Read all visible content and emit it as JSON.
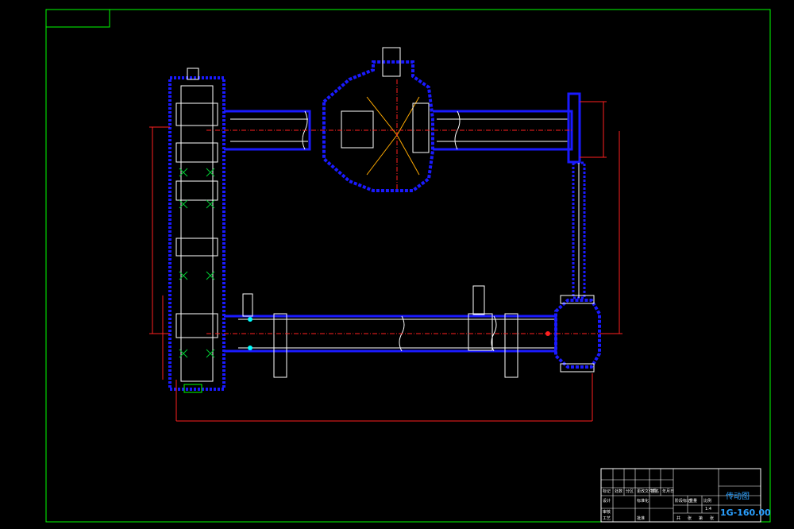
{
  "title_block": {
    "drawing_name": "传动图",
    "drawing_code": "1G-160.00",
    "labels": [
      "标记",
      "处数",
      "分区",
      "更改文件号",
      "签名",
      "年月日",
      "设计",
      "标准化",
      "审核",
      "工艺",
      "批准",
      "阶段标记",
      "重量",
      "比例",
      "共",
      "张",
      "第",
      "张"
    ],
    "scale": "1:4"
  },
  "colors": {
    "frame": "#00ff00",
    "part": "#1a1aff",
    "outline": "#ffffff",
    "dimension": "#ff2020",
    "hatch": "#00cc33",
    "accent": "#00ffff",
    "title": "#2aa0ff"
  }
}
